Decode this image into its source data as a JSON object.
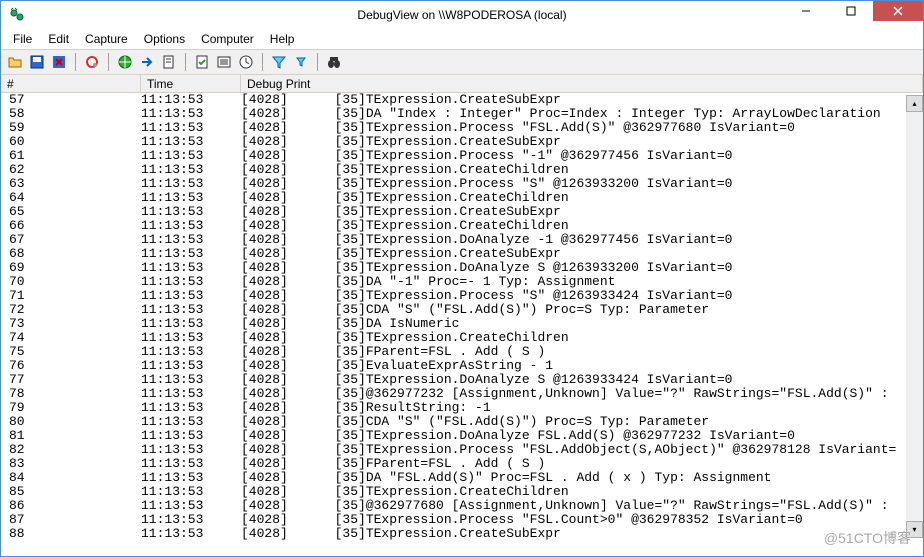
{
  "window": {
    "title": "DebugView on \\\\W8PODEROSA (local)"
  },
  "menu": {
    "file": "File",
    "edit": "Edit",
    "capture": "Capture",
    "options": "Options",
    "computer": "Computer",
    "help": "Help"
  },
  "columns": {
    "num": "#",
    "time": "Time",
    "print": "Debug Print"
  },
  "rows": [
    {
      "n": "57",
      "t": "11:13:53",
      "p": "[4028]",
      "m": "[35]TExpression.CreateSubExpr"
    },
    {
      "n": "58",
      "t": "11:13:53",
      "p": "[4028]",
      "m": "[35]DA \"Index : Integer\" Proc=Index : Integer Typ: ArrayLowDeclaration"
    },
    {
      "n": "59",
      "t": "11:13:53",
      "p": "[4028]",
      "m": "[35]TExpression.Process \"FSL.Add(S)\" @362977680 IsVariant=0"
    },
    {
      "n": "60",
      "t": "11:13:53",
      "p": "[4028]",
      "m": "[35]TExpression.CreateSubExpr"
    },
    {
      "n": "61",
      "t": "11:13:53",
      "p": "[4028]",
      "m": "[35]TExpression.Process \"-1\" @362977456 IsVariant=0"
    },
    {
      "n": "62",
      "t": "11:13:53",
      "p": "[4028]",
      "m": "[35]TExpression.CreateChildren"
    },
    {
      "n": "63",
      "t": "11:13:53",
      "p": "[4028]",
      "m": "[35]TExpression.Process \"S\" @1263933200 IsVariant=0"
    },
    {
      "n": "64",
      "t": "11:13:53",
      "p": "[4028]",
      "m": "[35]TExpression.CreateChildren"
    },
    {
      "n": "65",
      "t": "11:13:53",
      "p": "[4028]",
      "m": "[35]TExpression.CreateSubExpr"
    },
    {
      "n": "66",
      "t": "11:13:53",
      "p": "[4028]",
      "m": "[35]TExpression.CreateChildren"
    },
    {
      "n": "67",
      "t": "11:13:53",
      "p": "[4028]",
      "m": "[35]TExpression.DoAnalyze -1 @362977456 IsVariant=0"
    },
    {
      "n": "68",
      "t": "11:13:53",
      "p": "[4028]",
      "m": "[35]TExpression.CreateSubExpr"
    },
    {
      "n": "69",
      "t": "11:13:53",
      "p": "[4028]",
      "m": "[35]TExpression.DoAnalyze S @1263933200 IsVariant=0"
    },
    {
      "n": "70",
      "t": "11:13:53",
      "p": "[4028]",
      "m": "[35]DA \"-1\" Proc=- 1 Typ: Assignment"
    },
    {
      "n": "71",
      "t": "11:13:53",
      "p": "[4028]",
      "m": "[35]TExpression.Process \"S\" @1263933424 IsVariant=0"
    },
    {
      "n": "72",
      "t": "11:13:53",
      "p": "[4028]",
      "m": "[35]CDA \"S\" (\"FSL.Add(S)\") Proc=S Typ: Parameter"
    },
    {
      "n": "73",
      "t": "11:13:53",
      "p": "[4028]",
      "m": "[35]DA IsNumeric"
    },
    {
      "n": "74",
      "t": "11:13:53",
      "p": "[4028]",
      "m": "[35]TExpression.CreateChildren"
    },
    {
      "n": "75",
      "t": "11:13:53",
      "p": "[4028]",
      "m": "[35]FParent=FSL . Add ( S )"
    },
    {
      "n": "76",
      "t": "11:13:53",
      "p": "[4028]",
      "m": "[35]EvaluateExprAsString - 1"
    },
    {
      "n": "77",
      "t": "11:13:53",
      "p": "[4028]",
      "m": "[35]TExpression.DoAnalyze S @1263933424 IsVariant=0"
    },
    {
      "n": "78",
      "t": "11:13:53",
      "p": "[4028]",
      "m": "[35]@362977232 [Assignment,Unknown] Value=\"?\" RawStrings=\"FSL.Add(S)\" :"
    },
    {
      "n": "79",
      "t": "11:13:53",
      "p": "[4028]",
      "m": "[35]ResultString: -1"
    },
    {
      "n": "80",
      "t": "11:13:53",
      "p": "[4028]",
      "m": "[35]CDA \"S\" (\"FSL.Add(S)\") Proc=S Typ: Parameter"
    },
    {
      "n": "81",
      "t": "11:13:53",
      "p": "[4028]",
      "m": "[35]TExpression.DoAnalyze FSL.Add(S) @362977232 IsVariant=0"
    },
    {
      "n": "82",
      "t": "11:13:53",
      "p": "[4028]",
      "m": "[35]TExpression.Process \"FSL.AddObject(S,AObject)\" @362978128 IsVariant="
    },
    {
      "n": "83",
      "t": "11:13:53",
      "p": "[4028]",
      "m": "[35]FParent=FSL . Add ( S )"
    },
    {
      "n": "84",
      "t": "11:13:53",
      "p": "[4028]",
      "m": "[35]DA \"FSL.Add(S)\" Proc=FSL . Add ( x ) Typ: Assignment"
    },
    {
      "n": "85",
      "t": "11:13:53",
      "p": "[4028]",
      "m": "[35]TExpression.CreateChildren"
    },
    {
      "n": "86",
      "t": "11:13:53",
      "p": "[4028]",
      "m": "[35]@362977680 [Assignment,Unknown] Value=\"?\" RawStrings=\"FSL.Add(S)\" :"
    },
    {
      "n": "87",
      "t": "11:13:53",
      "p": "[4028]",
      "m": "[35]TExpression.Process \"FSL.Count>0\" @362978352 IsVariant=0"
    },
    {
      "n": "88",
      "t": "11:13:53",
      "p": "[4028]",
      "m": "[35]TExpression.CreateSubExpr"
    }
  ],
  "watermark": "@51CTO博客"
}
